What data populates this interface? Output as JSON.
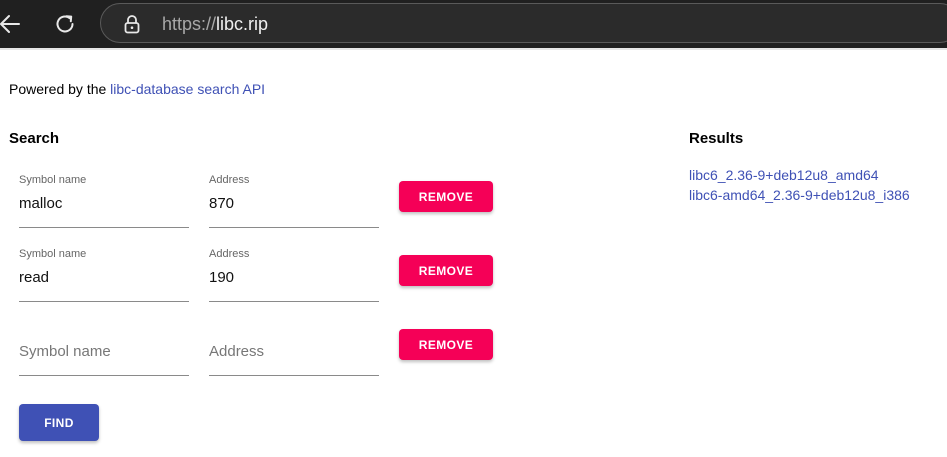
{
  "browser": {
    "url_scheme": "https://",
    "url_host": "libc.rip"
  },
  "header": {
    "powered_prefix": "Powered by the ",
    "powered_link": "libc-database search API"
  },
  "search": {
    "title": "Search",
    "rows": [
      {
        "symbol_label": "Symbol name",
        "symbol_value": "malloc",
        "address_label": "Address",
        "address_value": "870",
        "remove_label": "REMOVE"
      },
      {
        "symbol_label": "Symbol name",
        "symbol_value": "read",
        "address_label": "Address",
        "address_value": "190",
        "remove_label": "REMOVE"
      },
      {
        "symbol_placeholder": "Symbol name",
        "address_placeholder": "Address",
        "remove_label": "REMOVE"
      }
    ],
    "find_label": "FIND"
  },
  "results": {
    "title": "Results",
    "items": [
      "libc6_2.36-9+deb12u8_amd64",
      "libc6-amd64_2.36-9+deb12u8_i386"
    ]
  },
  "colors": {
    "primary": "#3f51b5",
    "accent": "#f50057",
    "chrome": "#202020"
  }
}
